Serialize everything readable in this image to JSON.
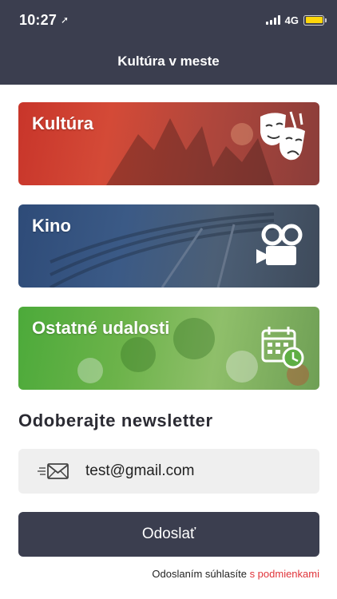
{
  "status_bar": {
    "time": "10:27",
    "location_icon": "location-arrow-icon",
    "network": "4G",
    "battery_color": "#ffd60a"
  },
  "header": {
    "title": "Kultúra v meste",
    "background": "#3b3e4f"
  },
  "categories": [
    {
      "label": "Kultúra",
      "icon": "theater-masks-icon",
      "color": "#c8352a"
    },
    {
      "label": "Kino",
      "icon": "movie-camera-icon",
      "color": "#2e4b78"
    },
    {
      "label": "Ostatné udalosti",
      "icon": "calendar-clock-icon",
      "color": "#4caa3a"
    }
  ],
  "newsletter": {
    "title": "Odoberajte newsletter",
    "email_value": "test@gmail.com",
    "email_icon": "mail-send-icon",
    "submit_label": "Odoslať",
    "terms_text": "Odoslaním súhlasíte",
    "terms_link": "s podmienkami",
    "link_color": "#e0343a"
  }
}
